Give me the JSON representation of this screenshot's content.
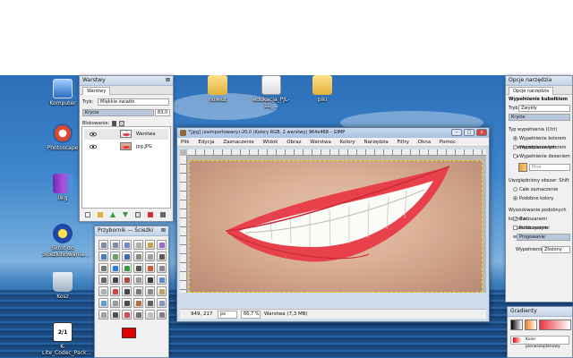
{
  "desktop": {
    "icons": [
      {
        "label": "Komputer"
      },
      {
        "label": "Photoscape"
      },
      {
        "label": "ilkg"
      },
      {
        "label": "Skrót do SciezkiNowania..."
      },
      {
        "label": "Kosz"
      },
      {
        "label": "K-Lite_Codec_Pack..."
      },
      {
        "label": "nowiut"
      },
      {
        "label": "edukacja_PJL-1L_..."
      },
      {
        "label": "piki"
      }
    ],
    "k_lite_badge": "2/1"
  },
  "layers_panel": {
    "title": "Warstwy",
    "tab": "Warstwy",
    "mode_label": "Tryb:",
    "mode_value": "Miękkie światło",
    "opacity_label": "Krycie",
    "opacity_value": "83,0",
    "lock_label": "Blokowanie:",
    "layers": [
      {
        "name": "Warstwa"
      },
      {
        "name": "jpg.JPG"
      }
    ]
  },
  "toolbox": {
    "title": "Przybornik — Ścieżki"
  },
  "tool_options": {
    "title": "Opcje narzędzia",
    "tab": "Opcje narzędzia",
    "tool_name": "Wypełnienie kubełkiem",
    "mode_label": "Tryb:",
    "mode_value": "Zwykły",
    "opacity_label": "Krycie",
    "fill_type_label": "Typ wypełnienia (Ctrl)",
    "fill_options": [
      "Wypełnienie kolorem pierwszoplanowym",
      "Wypełnienie kolorem tła",
      "Wypełnienie deseniem"
    ],
    "pattern_name": "Pine",
    "area_label": "Uwzględniony obszar: Shift",
    "area_options": [
      "Całe zaznaczenie",
      "Podobne kolory"
    ],
    "similar_label": "Wyszukiwanie podobnych kolorów",
    "checkboxes": [
      "Z obszarami przezroczystymi",
      "Próbkowanie wszystkich warstw"
    ],
    "threshold_label": "Progowanie",
    "fill_by_label": "Wypełnienie",
    "fill_by_value": "Złożony"
  },
  "gradients_panel": {
    "title": "Gradienty",
    "item": "Kolor pierwszoplanowy"
  },
  "gimp_window": {
    "title": "*[jpg] (zaimportowany)-20.0 (Kolory RGB, 2 warstwy) 964x468 – GIMP",
    "menu": [
      "Plik",
      "Edycja",
      "Zaznaczenie",
      "Widok",
      "Obraz",
      "Warstwa",
      "Kolory",
      "Narzędzia",
      "Filtry",
      "Okna",
      "Pomoc"
    ],
    "coords": "949, 217",
    "unit": "px",
    "zoom": "66,7 %",
    "status": "Warstwa (7,3 MB)"
  }
}
